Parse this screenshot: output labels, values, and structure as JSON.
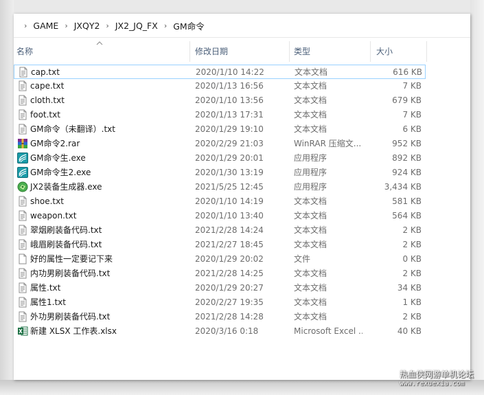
{
  "breadcrumb": [
    "GAME",
    "JXQY2",
    "JX2_JQ_FX",
    "GM命令"
  ],
  "columns": {
    "name": "名称",
    "date": "修改日期",
    "type": "类型",
    "size": "大小"
  },
  "files": [
    {
      "name": "cap.txt",
      "date": "2020/1/10 14:22",
      "type": "文本文档",
      "size": "616 KB",
      "icon": "text-file-icon"
    },
    {
      "name": "cape.txt",
      "date": "2020/1/13 16:56",
      "type": "文本文档",
      "size": "7 KB",
      "icon": "text-file-icon"
    },
    {
      "name": "cloth.txt",
      "date": "2020/1/10 13:56",
      "type": "文本文档",
      "size": "679 KB",
      "icon": "text-file-icon"
    },
    {
      "name": "foot.txt",
      "date": "2020/1/13 17:31",
      "type": "文本文档",
      "size": "7 KB",
      "icon": "text-file-icon"
    },
    {
      "name": "GM命令（未翻译）.txt",
      "date": "2020/1/29 19:10",
      "type": "文本文档",
      "size": "6 KB",
      "icon": "text-file-icon"
    },
    {
      "name": "GM命令2.rar",
      "date": "2020/2/29 21:03",
      "type": "WinRAR 压缩文...",
      "size": "952 KB",
      "icon": "winrar-archive-icon"
    },
    {
      "name": "GM命令生.exe",
      "date": "2020/1/29 20:01",
      "type": "应用程序",
      "size": "892 KB",
      "icon": "application-icon"
    },
    {
      "name": "GM命令生2.exe",
      "date": "2020/1/30 13:19",
      "type": "应用程序",
      "size": "924 KB",
      "icon": "application-icon"
    },
    {
      "name": "JX2装备生成器.exe",
      "date": "2021/5/25 12:45",
      "type": "应用程序",
      "size": "3,434 KB",
      "icon": "generator-app-icon"
    },
    {
      "name": "shoe.txt",
      "date": "2020/1/10 14:19",
      "type": "文本文档",
      "size": "581 KB",
      "icon": "text-file-icon"
    },
    {
      "name": "weapon.txt",
      "date": "2020/1/10 13:40",
      "type": "文本文档",
      "size": "564 KB",
      "icon": "text-file-icon"
    },
    {
      "name": "翠烟刷装备代码.txt",
      "date": "2021/2/28 14:24",
      "type": "文本文档",
      "size": "2 KB",
      "icon": "text-file-icon"
    },
    {
      "name": "峨眉刷装备代码.txt",
      "date": "2021/2/27 18:45",
      "type": "文本文档",
      "size": "2 KB",
      "icon": "text-file-icon"
    },
    {
      "name": "好的属性一定要记下来",
      "date": "2020/1/29 20:02",
      "type": "文件",
      "size": "0 KB",
      "icon": "blank-file-icon"
    },
    {
      "name": "内功男刷装备代码.txt",
      "date": "2021/2/28 14:25",
      "type": "文本文档",
      "size": "2 KB",
      "icon": "text-file-icon"
    },
    {
      "name": "属性.txt",
      "date": "2020/1/29 20:27",
      "type": "文本文档",
      "size": "34 KB",
      "icon": "text-file-icon"
    },
    {
      "name": "属性1.txt",
      "date": "2020/2/27 19:35",
      "type": "文本文档",
      "size": "1 KB",
      "icon": "text-file-icon"
    },
    {
      "name": "外功男刷装备代码.txt",
      "date": "2021/2/28 14:28",
      "type": "文本文档",
      "size": "2 KB",
      "icon": "text-file-icon"
    },
    {
      "name": "新建 XLSX 工作表.xlsx",
      "date": "2020/3/16 0:18",
      "type": "Microsoft Excel ...",
      "size": "40 KB",
      "icon": "excel-file-icon"
    }
  ],
  "watermark": {
    "title": "热血侠网游单机论坛",
    "url": "www.rexuexia.com"
  }
}
